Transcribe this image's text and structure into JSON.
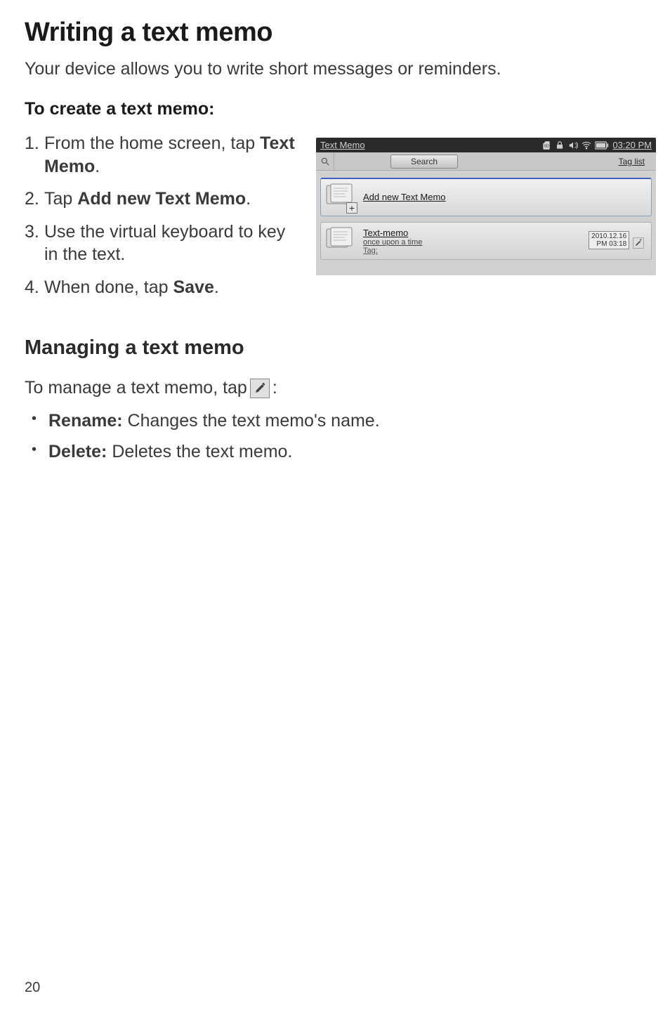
{
  "page": {
    "heading": "Writing a text memo",
    "intro": "Your device allows you to write short messages or reminders.",
    "section_title": "To create a text memo:",
    "steps": [
      {
        "pre": "From the home screen, tap ",
        "bold": "Text Memo",
        "post": "."
      },
      {
        "pre": "Tap ",
        "bold": "Add new Text Memo",
        "post": "."
      },
      {
        "pre": "Use the virtual keyboard to key in the text.",
        "bold": "",
        "post": ""
      },
      {
        "pre": "When done, tap ",
        "bold": "Save",
        "post": "."
      }
    ],
    "managing": {
      "heading": "Managing a text memo",
      "intro_pre": "To manage a text memo, tap ",
      "intro_post": ":",
      "items": [
        {
          "bold": "Rename:",
          "desc": " Changes the text memo's name."
        },
        {
          "bold": "Delete:",
          "desc": " Deletes the text memo."
        }
      ]
    },
    "page_number": "20"
  },
  "screenshot": {
    "statusbar": {
      "title": "Text Memo",
      "time": "03:20 PM"
    },
    "toolbar": {
      "search_label": "Search",
      "taglist_label": "Tag list"
    },
    "cards": {
      "add_new": "Add new Text Memo",
      "memo": {
        "title": "Text-memo",
        "subtitle": "once upon a time",
        "tag_label": "Tag:",
        "date": "2010.12.16",
        "time": "PM 03:18"
      }
    }
  }
}
